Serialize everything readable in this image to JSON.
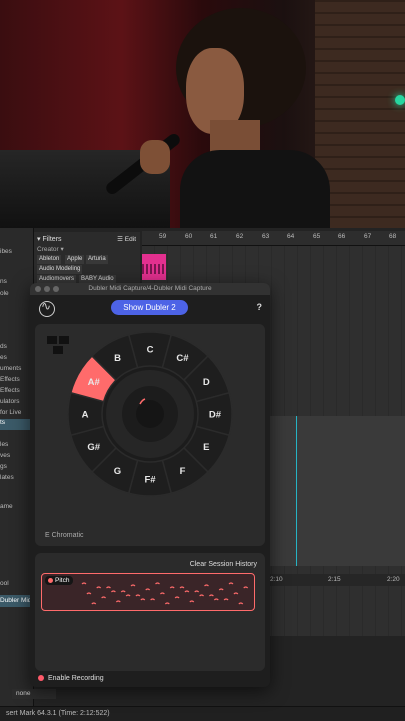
{
  "daw": {
    "ruler_ticks": [
      "59",
      "60",
      "61",
      "62",
      "63",
      "64",
      "65",
      "66",
      "67",
      "68"
    ],
    "timeline2_ticks": [
      "2:10",
      "2:15",
      "2:20"
    ],
    "left_items": [
      "ibes",
      "ns",
      "ole",
      "ds",
      "es",
      "uments",
      "Effects",
      "Effects",
      "ulators",
      "for Live",
      "ts",
      "les",
      "ves",
      "gs",
      "lates",
      "ame",
      "ool"
    ],
    "left_selected_index": 10,
    "filters": {
      "title": "Filters",
      "edit": "Edit",
      "creator": "Creator",
      "tags": [
        "Ableton",
        "Apple",
        "Arturia",
        "Audio Modeling",
        "Audiomovers",
        "BABY Audio"
      ]
    },
    "midi_capture_track": "Dubler Midi",
    "none_value": "none",
    "status": "sert Mark 64.3.1 (Time: 2:12:522)"
  },
  "plugin": {
    "window_title": "Dubler Midi Capture/4-Dubler Midi Capture",
    "show_button": "Show Dubler 2",
    "help": "?",
    "notes": [
      "C",
      "C#",
      "D",
      "D#",
      "E",
      "F",
      "F#",
      "G",
      "G#",
      "A",
      "A#",
      "B"
    ],
    "active_note": "A#",
    "scale_label": "E Chromatic",
    "clear_history": "Clear Session History",
    "pitch_label": "Pitch",
    "enable_recording": "Enable Recording"
  },
  "colors": {
    "accent_blue": "#4d63e6",
    "active_note": "#ff6b6b",
    "clip_pink": "#e3308f",
    "cursor": "#26b3c4"
  }
}
